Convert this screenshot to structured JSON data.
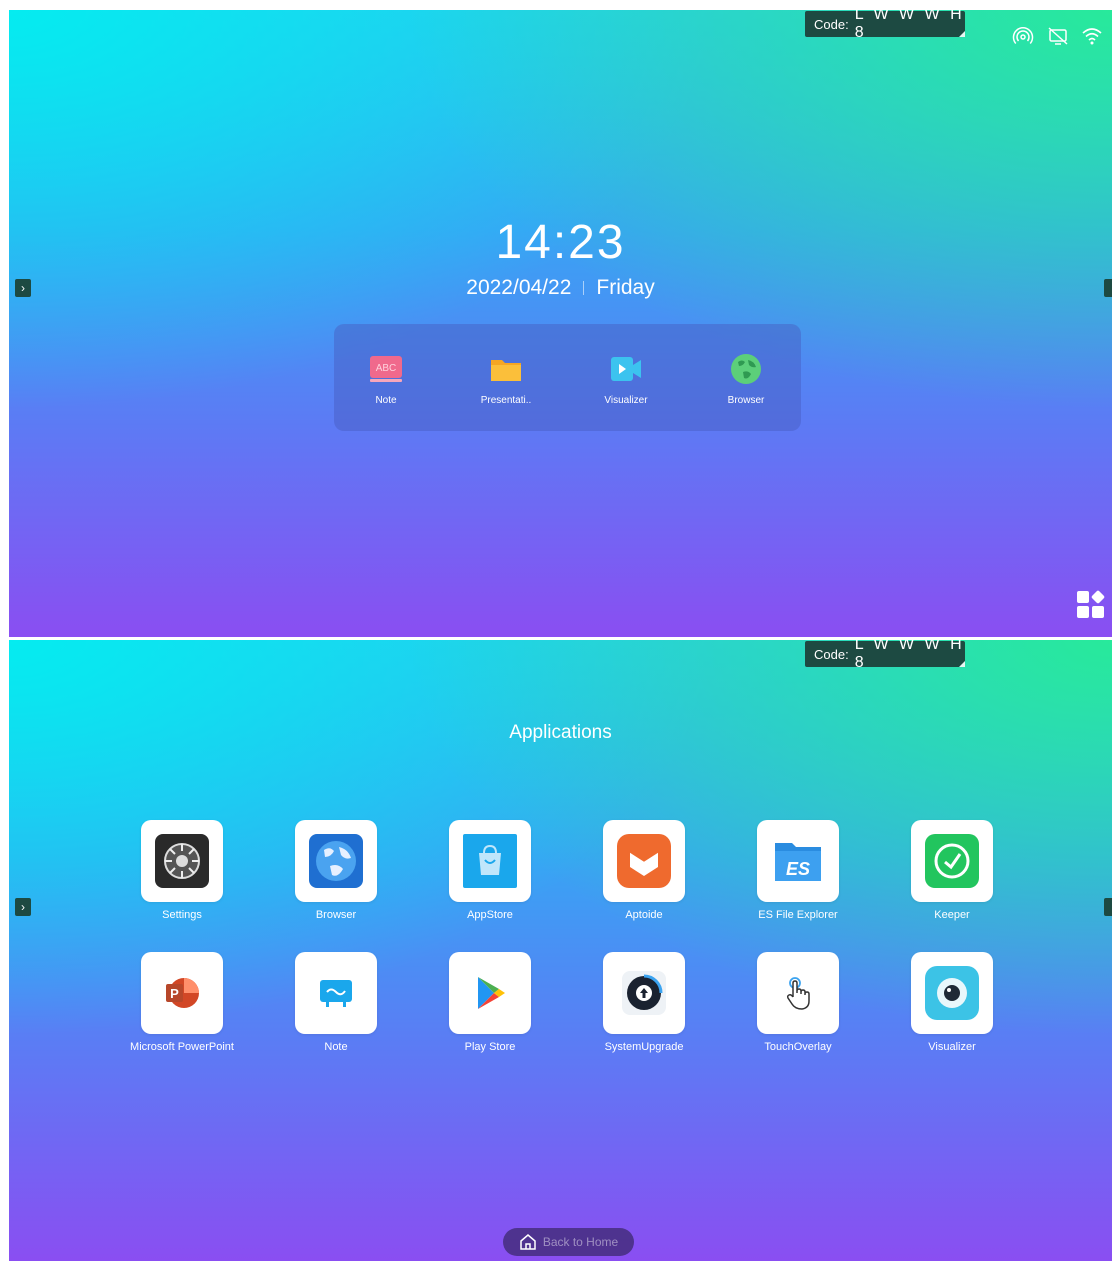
{
  "home": {
    "code_label": "Code:",
    "code_value": "L W W W H 8",
    "time": "14:23",
    "date": "2022/04/22",
    "weekday": "Friday",
    "status_icons": [
      "hotspot-icon",
      "screen-share-off-icon",
      "wifi-icon"
    ],
    "dock": [
      {
        "label": "Note",
        "icon": "note-icon"
      },
      {
        "label": "Presentati..",
        "icon": "folder-icon"
      },
      {
        "label": "Visualizer",
        "icon": "camera-icon"
      },
      {
        "label": "Browser",
        "icon": "globe-icon"
      }
    ],
    "bottom_right_icon": "apps-grid-icon"
  },
  "apps": {
    "code_label": "Code:",
    "code_value": "L W W W H 8",
    "title": "Applications",
    "items": [
      {
        "label": "Settings",
        "icon": "settings-icon"
      },
      {
        "label": "Browser",
        "icon": "globe-icon"
      },
      {
        "label": "AppStore",
        "icon": "shopping-bag-icon"
      },
      {
        "label": "Aptoide",
        "icon": "aptoide-icon"
      },
      {
        "label": "ES File Explorer",
        "icon": "es-file-icon"
      },
      {
        "label": "Keeper",
        "icon": "keeper-icon"
      },
      {
        "label": "Microsoft PowerPoint",
        "icon": "powerpoint-icon"
      },
      {
        "label": "Note",
        "icon": "note-icon"
      },
      {
        "label": "Play Store",
        "icon": "play-store-icon"
      },
      {
        "label": "SystemUpgrade",
        "icon": "upgrade-icon"
      },
      {
        "label": "TouchOverlay",
        "icon": "touch-hand-icon"
      },
      {
        "label": "Visualizer",
        "icon": "camera-icon"
      }
    ],
    "back_home_label": "Back to Home"
  },
  "colors": {
    "badge_bg": "#1d4a42",
    "gradient_top": "#2bc6ef",
    "gradient_bottom": "#8a4ef2"
  }
}
